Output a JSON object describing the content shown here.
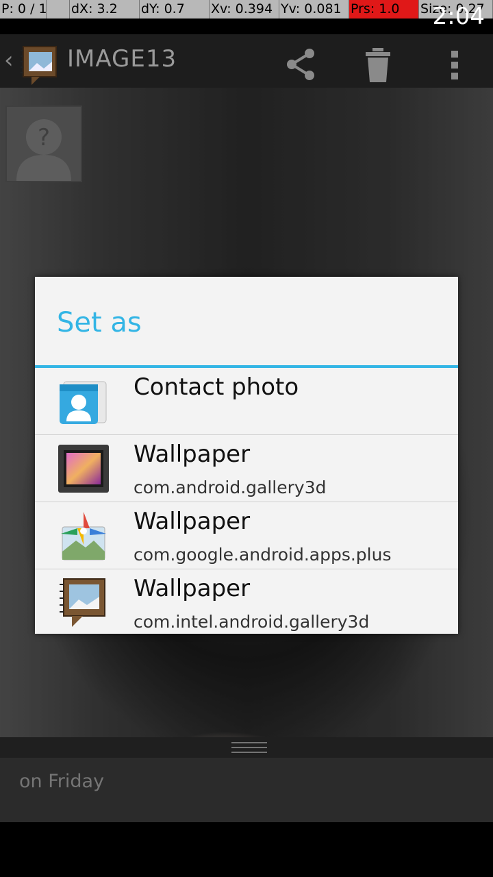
{
  "debug_overlay": {
    "pointer": "P: 0 / 1",
    "dx": "dX: 3.2",
    "dy": "dY: 0.7",
    "xv": "Xv: 0.394",
    "yv": "Yv: 0.081",
    "prs": "Prs: 1.0",
    "size": "Size: 0.27"
  },
  "status_bar": {
    "time": "2:04"
  },
  "action_bar": {
    "title": "IMAGE13",
    "icons": [
      "back-chevron-icon",
      "gallery-app-icon",
      "share-icon",
      "trash-icon",
      "overflow-menu-icon"
    ]
  },
  "dialog": {
    "title": "Set as",
    "accent_color": "#33b5e5",
    "options": [
      {
        "icon": "contacts-icon",
        "label": "Contact photo",
        "package": ""
      },
      {
        "icon": "gallery-wallpaper-icon",
        "label": "Wallpaper",
        "package": "com.android.gallery3d"
      },
      {
        "icon": "google-photos-icon",
        "label": "Wallpaper",
        "package": "com.google.android.apps.plus"
      },
      {
        "icon": "intel-gallery-icon",
        "label": "Wallpaper",
        "package": "com.intel.android.gallery3d"
      }
    ]
  },
  "drawer": {
    "text": "on Friday"
  }
}
